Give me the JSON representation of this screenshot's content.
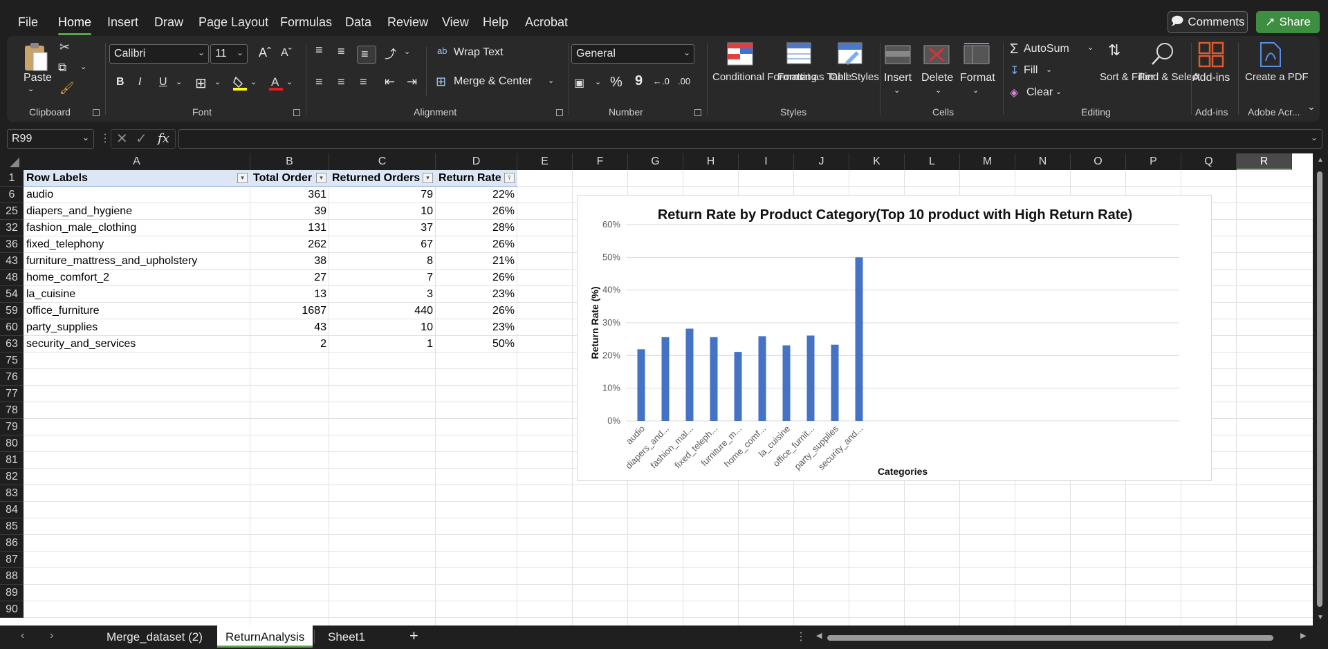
{
  "menu": {
    "tabs": [
      "File",
      "Home",
      "Insert",
      "Draw",
      "Page Layout",
      "Formulas",
      "Data",
      "Review",
      "View",
      "Help",
      "Acrobat"
    ],
    "active_tab": "Home",
    "comments_label": "Comments",
    "share_label": "Share"
  },
  "ribbon": {
    "clipboard": {
      "paste": "Paste",
      "group": "Clipboard"
    },
    "font": {
      "name": "Calibri",
      "size": "11",
      "group": "Font",
      "bold": "B",
      "italic": "I",
      "underline": "U"
    },
    "alignment": {
      "wrap_text": "Wrap Text",
      "merge_center": "Merge & Center",
      "group": "Alignment"
    },
    "number": {
      "format": "General",
      "percent": "%",
      "comma": "9",
      "group": "Number"
    },
    "styles": {
      "conditional": "Conditional Formatting",
      "format_table": "Format as Table",
      "cell_styles": "Cell Styles",
      "group": "Styles"
    },
    "cells": {
      "insert": "Insert",
      "delete": "Delete",
      "format": "Format",
      "group": "Cells"
    },
    "editing": {
      "autosum": "AutoSum",
      "fill": "Fill",
      "clear": "Clear",
      "sort_filter": "Sort & Filter",
      "find_select": "Find & Select",
      "group": "Editing"
    },
    "addins": {
      "label": "Add-ins",
      "group": "Add-ins"
    },
    "adobe": {
      "label": "Create a PDF",
      "group": "Adobe Acr..."
    }
  },
  "formula_bar": {
    "name_box": "R99",
    "fx": "fx",
    "value": ""
  },
  "columns": [
    "A",
    "B",
    "C",
    "D",
    "E",
    "F",
    "G",
    "H",
    "I",
    "J",
    "K",
    "L",
    "M",
    "N",
    "O",
    "P",
    "Q",
    "R"
  ],
  "selected_column": "R",
  "rows": [
    "1",
    "6",
    "25",
    "32",
    "36",
    "43",
    "48",
    "54",
    "59",
    "60",
    "63",
    "75",
    "76",
    "77",
    "78",
    "79",
    "80",
    "81",
    "82",
    "83",
    "84",
    "85",
    "86",
    "87",
    "88",
    "89",
    "90"
  ],
  "table": {
    "headers": [
      "Row Labels",
      "Total Order",
      "Returned Orders",
      "Return Rate"
    ],
    "data": [
      [
        "audio",
        "361",
        "79",
        "22%"
      ],
      [
        "diapers_and_hygiene",
        "39",
        "10",
        "26%"
      ],
      [
        "fashion_male_clothing",
        "131",
        "37",
        "28%"
      ],
      [
        "fixed_telephony",
        "262",
        "67",
        "26%"
      ],
      [
        "furniture_mattress_and_upholstery",
        "38",
        "8",
        "21%"
      ],
      [
        "home_comfort_2",
        "27",
        "7",
        "26%"
      ],
      [
        "la_cuisine",
        "13",
        "3",
        "23%"
      ],
      [
        "office_furniture",
        "1687",
        "440",
        "26%"
      ],
      [
        "party_supplies",
        "43",
        "10",
        "23%"
      ],
      [
        "security_and_services",
        "2",
        "1",
        "50%"
      ]
    ]
  },
  "chart_data": {
    "type": "bar",
    "title": "Return Rate by Product Category(Top 10 product with High Return Rate)",
    "xlabel": "Categories",
    "ylabel": "Return Rate (%)",
    "categories": [
      "audio",
      "diapers_and...",
      "fashion_mal...",
      "fixed_teleph...",
      "furniture_m...",
      "home_comf...",
      "la_cuisine",
      "office_furnit...",
      "party_supplies",
      "security_and..."
    ],
    "values": [
      0.219,
      0.256,
      0.282,
      0.256,
      0.211,
      0.259,
      0.231,
      0.261,
      0.233,
      0.5
    ],
    "yticks": [
      "0%",
      "10%",
      "20%",
      "30%",
      "40%",
      "50%",
      "60%"
    ],
    "ylim": [
      0,
      0.6
    ],
    "bar_color": "#4472c4",
    "grid": true,
    "legend": "none"
  },
  "sheets": {
    "tabs": [
      "Merge_dataset (2)",
      "ReturnAnalysis",
      "Sheet1"
    ],
    "active": "ReturnAnalysis",
    "add": "+"
  },
  "colors": {
    "accent": "#57a64a",
    "bar": "#4472c4",
    "header_fill": "#dde6f5"
  }
}
